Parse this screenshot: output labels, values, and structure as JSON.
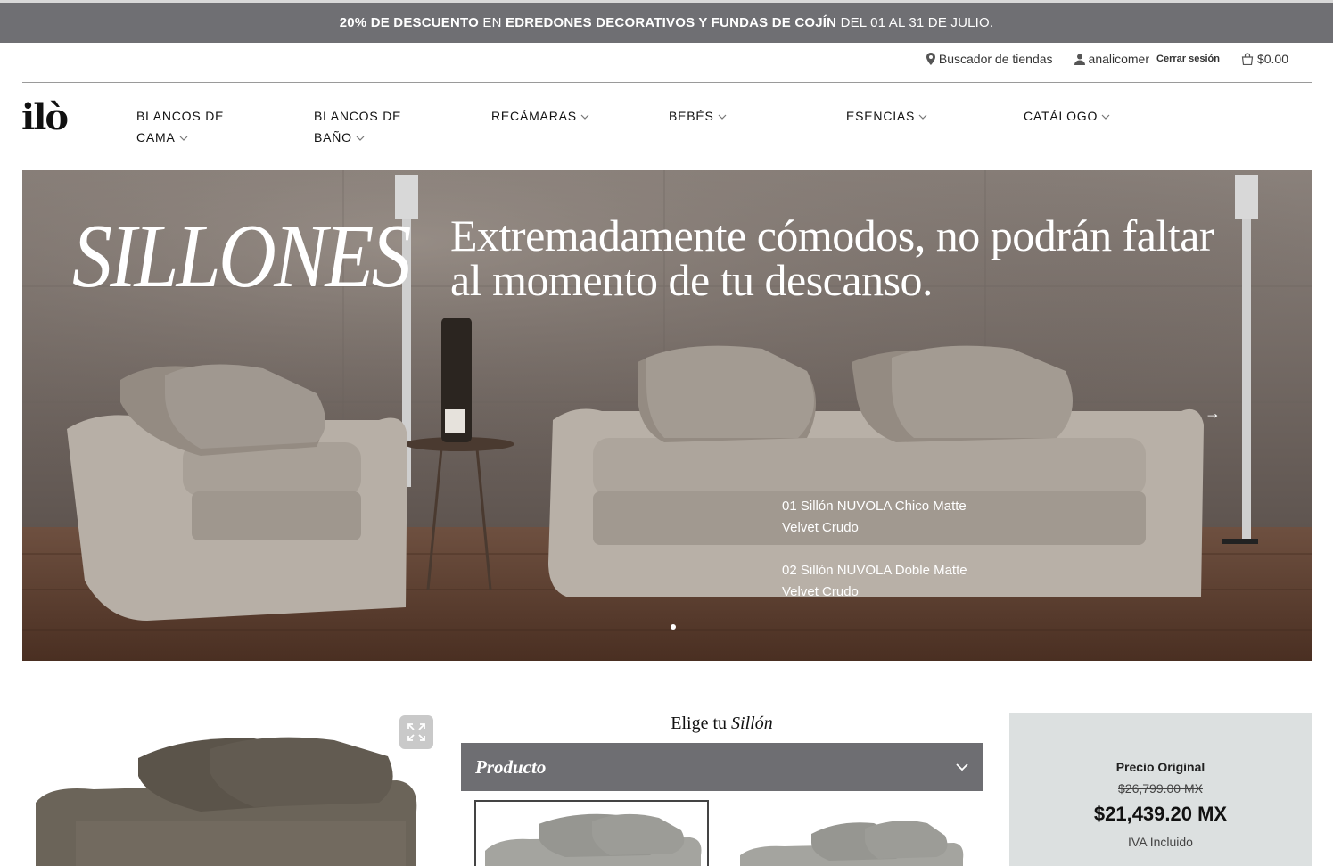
{
  "promo": {
    "part1": "20% DE DESCUENTO",
    "part2": " EN ",
    "part3": "EDREDONES DECORATIVOS Y FUNDAS DE COJÍN",
    "part4": " DEL 01 AL 31 DE JULIO."
  },
  "util": {
    "stores": "Buscador de tiendas",
    "user": "analicomer",
    "logout": "Cerrar sesión",
    "cart": "$0.00"
  },
  "logo": "ilò",
  "nav": {
    "item1": "BLANCOS DE",
    "item1b": "CAMA",
    "item2": "BLANCOS DE",
    "item2b": "BAÑO",
    "item3": "RECÁMARAS",
    "item4": "BEBÉS",
    "item5": "ESENCIAS",
    "item6": "CATÁLOGO"
  },
  "hero": {
    "title": "SILLONES",
    "subtitle": "Extremadamente cómodos, no podrán faltar al momento de tu descanso.",
    "caption1": "01 Sillón NUVOLA Chico Matte Velvet Crudo",
    "caption2": "02 Sillón NUVOLA Doble Matte Velvet Crudo",
    "next": "→"
  },
  "chooser": {
    "prefix": "Elige tu ",
    "italic": "Sillón",
    "select_label": "Producto"
  },
  "price": {
    "label": "Precio Original",
    "original": "$26,799.00 MX",
    "current": "$21,439.20 MX",
    "note": "IVA Incluido"
  },
  "colors": {
    "promo_bg": "#6f6f73",
    "select_bg": "#6e6e72",
    "price_bg": "#dce0e0"
  }
}
